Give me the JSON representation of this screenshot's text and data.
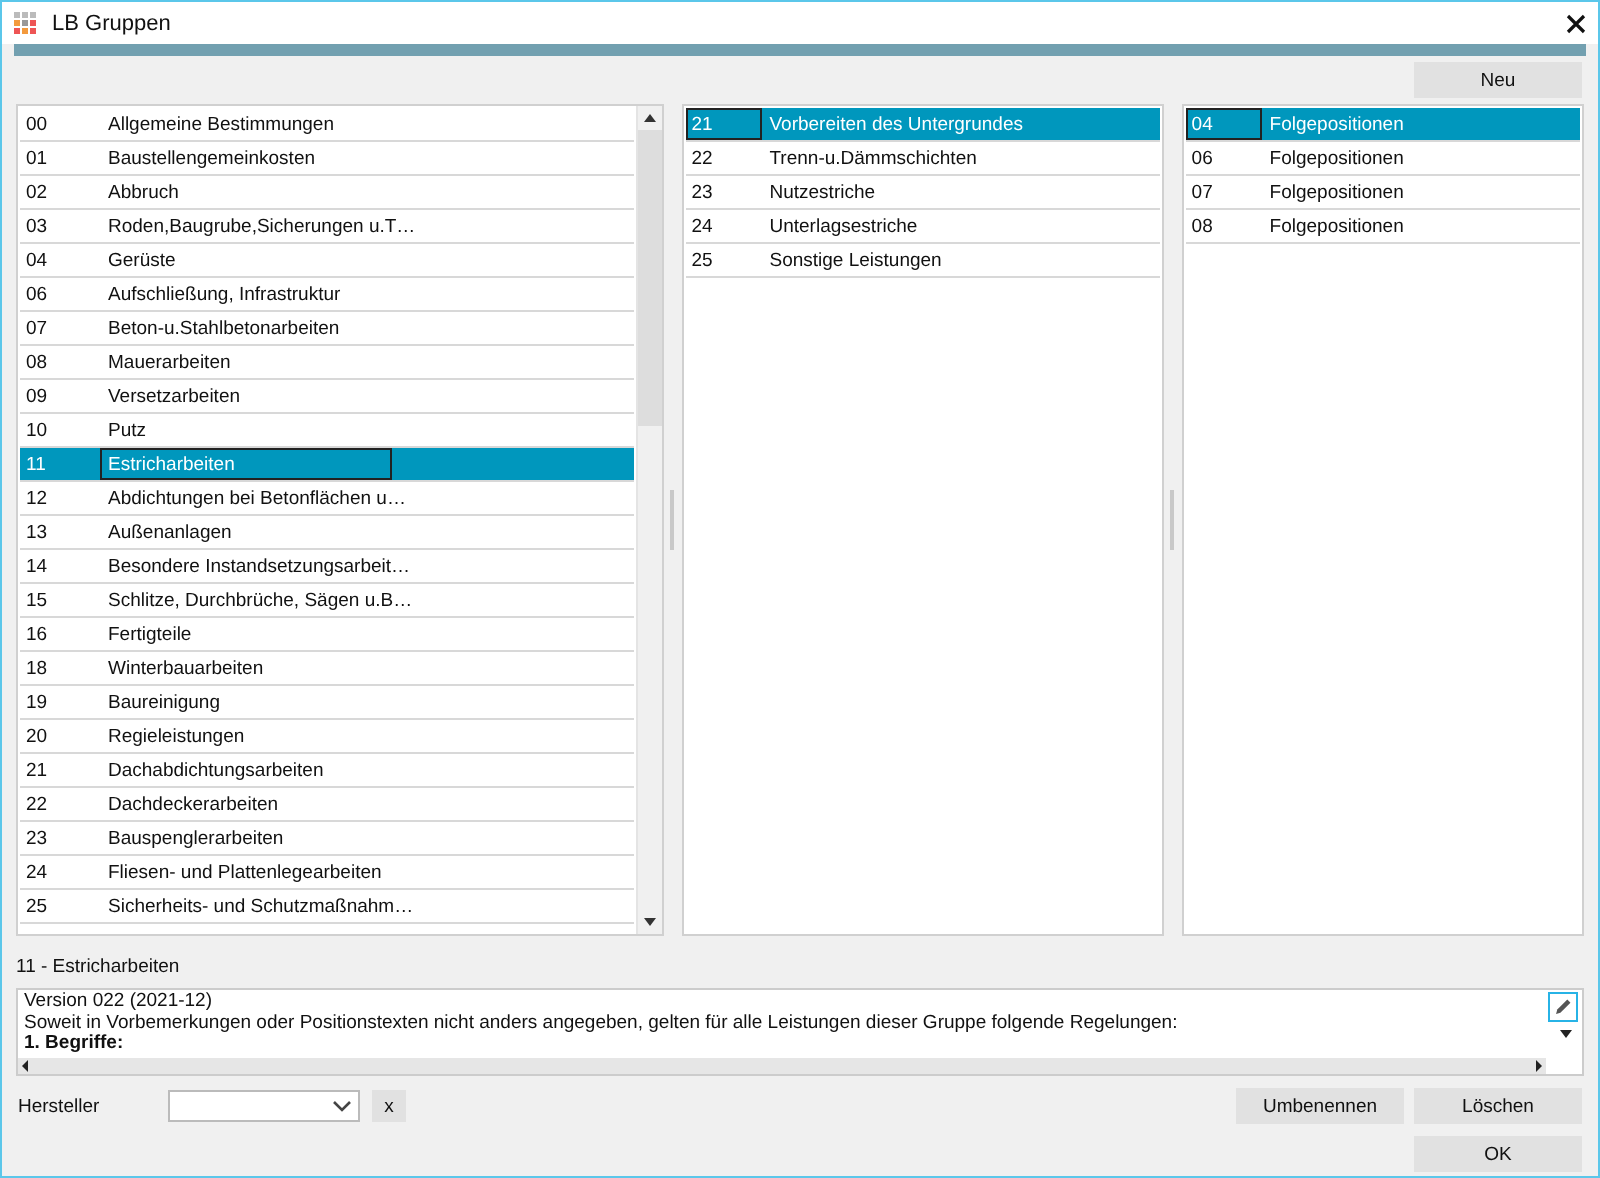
{
  "window": {
    "title": "LB Gruppen"
  },
  "new_button": "Neu",
  "lists": [
    {
      "focus_on_code": false,
      "scrollbar": true,
      "rows": [
        {
          "code": "00",
          "name": "Allgemeine Bestimmungen",
          "selected": false
        },
        {
          "code": "01",
          "name": "Baustellengemeinkosten",
          "selected": false
        },
        {
          "code": "02",
          "name": "Abbruch",
          "selected": false
        },
        {
          "code": "03",
          "name": "Roden,Baugrube,Sicherungen u.T…",
          "selected": false
        },
        {
          "code": "04",
          "name": "Gerüste",
          "selected": false
        },
        {
          "code": "06",
          "name": "Aufschließung, Infrastruktur",
          "selected": false
        },
        {
          "code": "07",
          "name": "Beton-u.Stahlbetonarbeiten",
          "selected": false
        },
        {
          "code": "08",
          "name": "Mauerarbeiten",
          "selected": false
        },
        {
          "code": "09",
          "name": "Versetzarbeiten",
          "selected": false
        },
        {
          "code": "10",
          "name": "Putz",
          "selected": false
        },
        {
          "code": "11",
          "name": "Estricharbeiten",
          "selected": true
        },
        {
          "code": "12",
          "name": "Abdichtungen bei Betonflächen u…",
          "selected": false
        },
        {
          "code": "13",
          "name": "Außenanlagen",
          "selected": false
        },
        {
          "code": "14",
          "name": "Besondere Instandsetzungsarbeit…",
          "selected": false
        },
        {
          "code": "15",
          "name": "Schlitze, Durchbrüche, Sägen u.B…",
          "selected": false
        },
        {
          "code": "16",
          "name": "Fertigteile",
          "selected": false
        },
        {
          "code": "18",
          "name": "Winterbauarbeiten",
          "selected": false
        },
        {
          "code": "19",
          "name": "Baureinigung",
          "selected": false
        },
        {
          "code": "20",
          "name": "Regieleistungen",
          "selected": false
        },
        {
          "code": "21",
          "name": "Dachabdichtungsarbeiten",
          "selected": false
        },
        {
          "code": "22",
          "name": "Dachdeckerarbeiten",
          "selected": false
        },
        {
          "code": "23",
          "name": "Bauspenglerarbeiten",
          "selected": false
        },
        {
          "code": "24",
          "name": "Fliesen- und Plattenlegearbeiten",
          "selected": false
        },
        {
          "code": "25",
          "name": "Sicherheits- und Schutzmaßnahm…",
          "selected": false
        }
      ]
    },
    {
      "focus_on_code": true,
      "scrollbar": false,
      "rows": [
        {
          "code": "21",
          "name": "Vorbereiten des Untergrundes",
          "selected": true
        },
        {
          "code": "22",
          "name": "Trenn-u.Dämmschichten",
          "selected": false
        },
        {
          "code": "23",
          "name": "Nutzestriche",
          "selected": false
        },
        {
          "code": "24",
          "name": "Unterlagsestriche",
          "selected": false
        },
        {
          "code": "25",
          "name": "Sonstige Leistungen",
          "selected": false
        }
      ]
    },
    {
      "focus_on_code": true,
      "scrollbar": false,
      "rows": [
        {
          "code": "04",
          "name": "Folgepositionen",
          "selected": true
        },
        {
          "code": "06",
          "name": "Folgepositionen",
          "selected": false
        },
        {
          "code": "07",
          "name": "Folgepositionen",
          "selected": false
        },
        {
          "code": "08",
          "name": "Folgepositionen",
          "selected": false
        }
      ]
    }
  ],
  "detail_title": "11 - Estricharbeiten",
  "description": {
    "lines": [
      "Version 022 (2021-12)",
      "Soweit in Vorbemerkungen oder Positionstexten nicht anders angegeben, gelten für alle Leistungen dieser Gruppe folgende Regelungen:",
      "**1. Begriffe:**"
    ]
  },
  "manufacturer": {
    "label": "Hersteller",
    "clear": "x"
  },
  "buttons": {
    "rename": "Umbenennen",
    "delete": "Löschen",
    "ok": "OK"
  }
}
